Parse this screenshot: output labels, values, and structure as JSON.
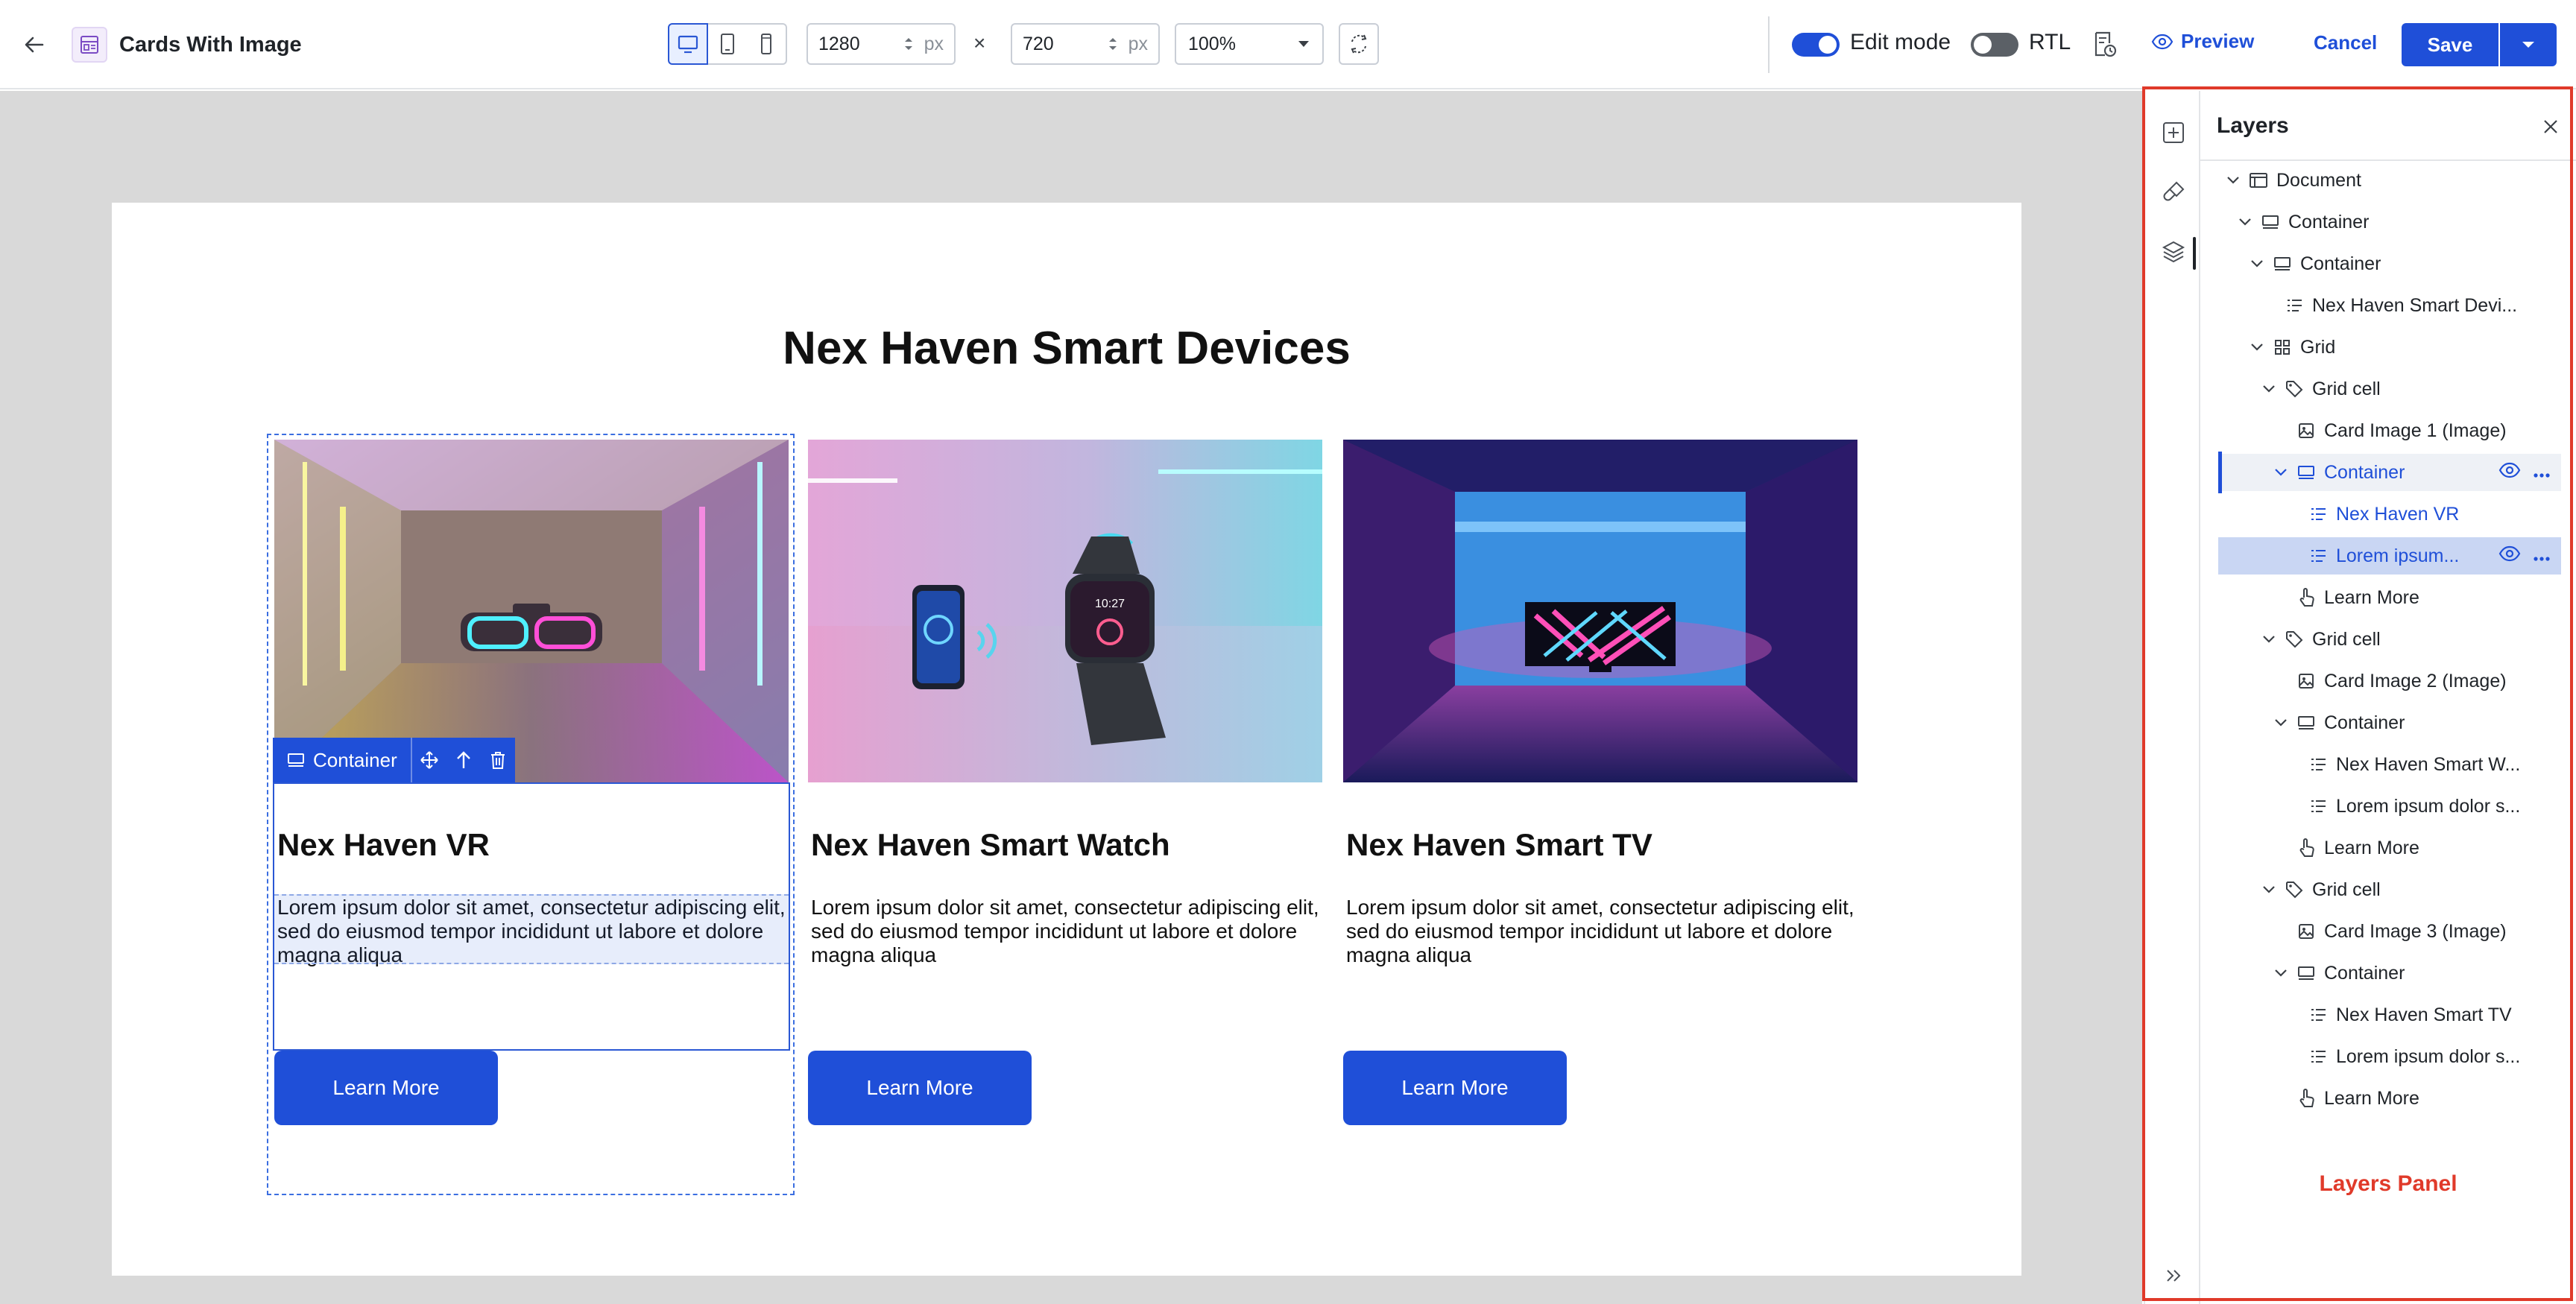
{
  "header": {
    "title": "Cards With Image",
    "width_value": "1280",
    "height_value": "720",
    "unit": "px",
    "times": "×",
    "zoom": "100%",
    "edit_mode_label": "Edit mode",
    "rtl_label": "RTL",
    "preview_label": "Preview",
    "cancel_label": "Cancel",
    "save_label": "Save"
  },
  "canvas": {
    "heading": "Nex Haven Smart Devices",
    "cards": [
      {
        "title": "Nex Haven VR",
        "body": "Lorem ipsum dolor sit amet, consectetur adipiscing elit, sed do eiusmod tempor incididunt ut labore et dolore magna aliqua",
        "button": "Learn More"
      },
      {
        "title": "Nex Haven Smart Watch",
        "body": "Lorem ipsum dolor sit amet, consectetur adipiscing elit, sed do eiusmod tempor incididunt ut labore et dolore magna aliqua",
        "button": "Learn More"
      },
      {
        "title": "Nex Haven Smart TV",
        "body": "Lorem ipsum dolor sit amet, consectetur adipiscing elit, sed do eiusmod tempor incididunt ut labore et dolore magna aliqua",
        "button": "Learn More"
      }
    ],
    "selection_toolbar_label": "Container",
    "watch_time": "10:27"
  },
  "layers": {
    "title": "Layers",
    "annotation": "Layers Panel",
    "rows": [
      {
        "label": "Document",
        "icon": "document-icon"
      },
      {
        "label": "Container",
        "icon": "container-icon"
      },
      {
        "label": "Container",
        "icon": "container-icon"
      },
      {
        "label": "Nex Haven Smart Devi...",
        "icon": "text-icon"
      },
      {
        "label": "Grid",
        "icon": "grid-icon"
      },
      {
        "label": "Grid cell",
        "icon": "tag-icon"
      },
      {
        "label": "Card Image 1 (Image)",
        "icon": "image-icon"
      },
      {
        "label": "Container",
        "icon": "container-icon"
      },
      {
        "label": "Nex Haven VR",
        "icon": "text-icon"
      },
      {
        "label": "Lorem ipsum...",
        "icon": "text-icon"
      },
      {
        "label": "Learn More",
        "icon": "pointer-icon"
      },
      {
        "label": "Grid cell",
        "icon": "tag-icon"
      },
      {
        "label": "Card Image 2 (Image)",
        "icon": "image-icon"
      },
      {
        "label": "Container",
        "icon": "container-icon"
      },
      {
        "label": "Nex Haven Smart W...",
        "icon": "text-icon"
      },
      {
        "label": "Lorem ipsum dolor s...",
        "icon": "text-icon"
      },
      {
        "label": "Learn More",
        "icon": "pointer-icon"
      },
      {
        "label": "Grid cell",
        "icon": "tag-icon"
      },
      {
        "label": "Card Image 3 (Image)",
        "icon": "image-icon"
      },
      {
        "label": "Container",
        "icon": "container-icon"
      },
      {
        "label": "Nex Haven Smart TV",
        "icon": "text-icon"
      },
      {
        "label": "Lorem ipsum dolor s...",
        "icon": "text-icon"
      },
      {
        "label": "Learn More",
        "icon": "pointer-icon"
      }
    ]
  },
  "colors": {
    "accent": "#1f4fd8",
    "annotation": "#e03a2a",
    "canvas_bg": "#d9d9d9",
    "selected_row": "#c9d6f3"
  }
}
